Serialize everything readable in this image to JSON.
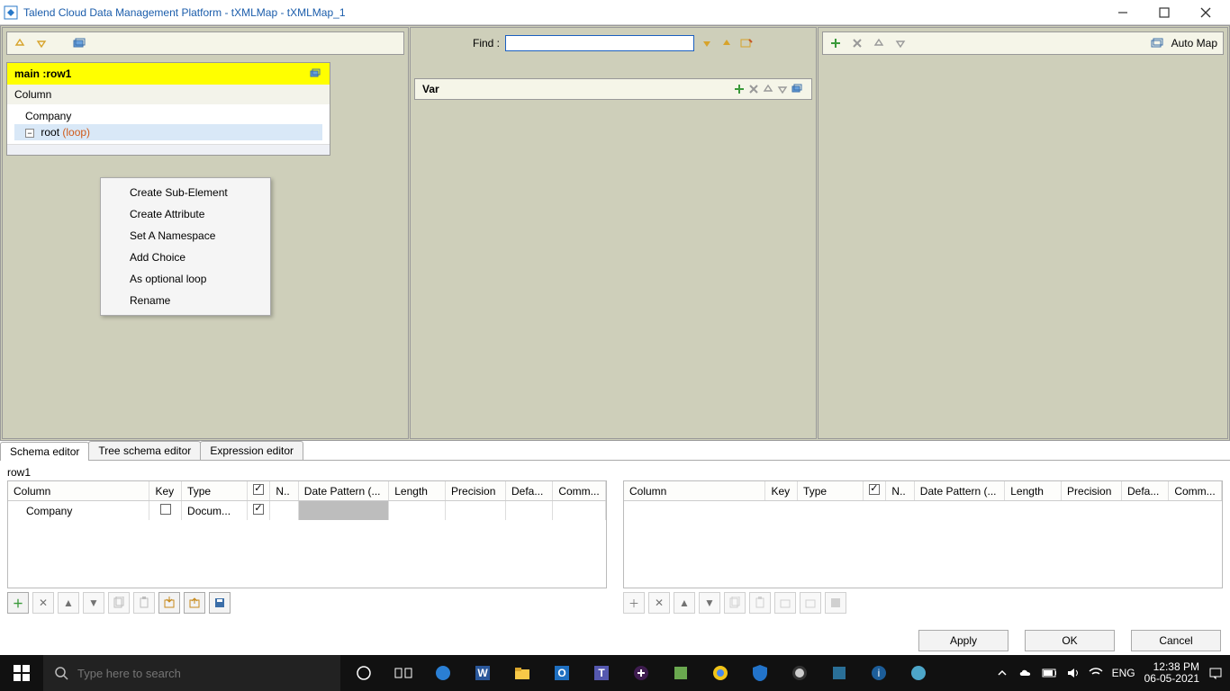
{
  "window": {
    "title": "Talend Cloud Data Management Platform - tXMLMap - tXMLMap_1"
  },
  "left_pane": {
    "tree_title": "main :row1",
    "column_header": "Column",
    "row_company": "Company",
    "tree_root": "root",
    "loop_tag": "(loop)"
  },
  "context_menu": {
    "items": [
      "Create Sub-Element",
      "Create Attribute",
      "Set A Namespace",
      "Add Choice",
      "As optional loop",
      "Rename"
    ]
  },
  "middle_pane": {
    "find_label": "Find :",
    "find_value": "",
    "var_label": "Var"
  },
  "right_pane": {
    "automap": "Auto Map"
  },
  "tabs": {
    "schema": "Schema editor",
    "tree": "Tree schema editor",
    "expression": "Expression editor"
  },
  "schema_editor": {
    "row_label": "row1",
    "headers": {
      "column": "Column",
      "key": "Key",
      "type": "Type",
      "n_chk": "✓",
      "n": "N..",
      "date_pattern": "Date Pattern (...",
      "length": "Length",
      "precision": "Precision",
      "default": "Defa...",
      "comment": "Comm..."
    },
    "row": {
      "column": "Company",
      "type": "Docum..."
    }
  },
  "footer": {
    "apply": "Apply",
    "ok": "OK",
    "cancel": "Cancel"
  },
  "taskbar": {
    "search_placeholder": "Type here to search",
    "lang": "ENG",
    "time": "12:38 PM",
    "date": "06-05-2021"
  }
}
